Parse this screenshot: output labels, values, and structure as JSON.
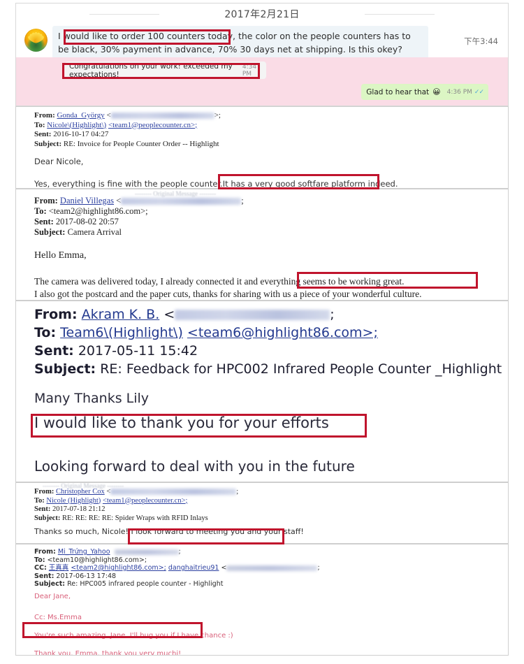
{
  "chat": {
    "date_label": "2017年2月21日",
    "avatar_name": "sunflower-avatar",
    "incoming_message": "I would like to order 100 counters today, the color on the people counters has to be black, 30% payment in advance, 70% 30 days net at shipping.  Is this okey?",
    "incoming_time": "下午3:44",
    "grey_message": "Congratulations on your work! exceeded my expectations!",
    "grey_time": "4:34 PM",
    "green_message": "Glad to hear that",
    "green_emoji": "😀",
    "green_time": "4:36 PM",
    "green_ticks": "✓✓"
  },
  "mail1": {
    "from_label": "From:",
    "from_name": "Gonda_György",
    "from_bracket_open": "<",
    "from_bracket_close": ">;",
    "to_label": "To:",
    "to_name": "Nicole\\(Highlight\\)",
    "to_address": "<team1@peoplecounter.cn>;",
    "sent_label": "Sent:",
    "sent_value": "2016-10-17 04:27",
    "subject_label": "Subject:",
    "subject_value": "RE: Invoice for People Counter Order -- Highlight",
    "greeting": "Dear Nicole,",
    "body_plain": "Yes, everything is fine with the people counter.",
    "body_highlighted": "It has a very good softfare platform indeed."
  },
  "mail2": {
    "original_message": "-------- Original Message --------",
    "from_label": "From:",
    "from_name": "Daniel Villegas",
    "from_bracket_open": "<",
    "from_bracket_close": ";",
    "to_label": "To:",
    "to_address": "<team2@highlight86.com>;",
    "sent_label": "Sent:",
    "sent_value": "2017-08-02 20:57",
    "subject_label": "Subject:",
    "subject_value": "Camera Arrival",
    "greeting": "Hello Emma,",
    "body_line1_plain": "The camera was delivered today, I already connected it and ",
    "body_line1_highlighted": "everything seems to be working great.",
    "body_line2": "I also got the postcard and the paper cuts, thanks for sharing with us a piece of your wonderful culture."
  },
  "mail3": {
    "from_label": "From:",
    "from_name": "Akram K. B.",
    "from_bracket_open": "<",
    "from_bracket_close": ";",
    "to_label": "To:",
    "to_name": "Team6\\(Highlight\\)",
    "to_address": "<team6@highlight86.com>;",
    "sent_label": "Sent:",
    "sent_value": "2017-05-11 15:42",
    "subject_label": "Subject:",
    "subject_value": "RE: Feedback for HPC002 Infrared People Counter _Highlight",
    "line1": "Many Thanks Lily",
    "line2_highlighted": "I would like to thank you for your efforts",
    "line3": "Looking forward to deal with you in the future"
  },
  "mail4": {
    "original_message": "-------- Original Message --------",
    "from_label": "From:",
    "from_name": "Christopher Cox",
    "from_bracket_open": "<",
    "from_bracket_close": ";",
    "to_label": "To:",
    "to_name": "Nicole (Highlight)",
    "to_address": "<team1@peoplecounter.cn>;",
    "sent_label": "Sent:",
    "sent_value": "2017-07-18 21:12",
    "subject_label": "Subject:",
    "subject_value": "RE: RE: RE: RE: Spider Wraps with RFID Inlays",
    "body_plain": "Thanks so much, Nicole!",
    "body_highlighted": "I look forward to meeting you and your staff!"
  },
  "mail5": {
    "from_label": "From:",
    "from_name": "Mi_Trứng_Yahoo",
    "from_bracket_close": ";",
    "to_label": "To:",
    "to_address": "<team10@highlight86.com>;",
    "cc_label": "CC:",
    "cc_name": "王真真",
    "cc_address": "<team2@highlight86.com>;",
    "cc_name2": "danghaitrieu91",
    "cc_bracket_open": "<",
    "cc_bracket_close": ";",
    "sent_label": "Sent:",
    "sent_value": "2017-06-13 17:48",
    "subject_label": "Subject:",
    "subject_value": "Re: HPC005 infrared people counter - Highlight",
    "greeting": "Dear Jane,",
    "cc_line": "Cc: Ms.Emma",
    "body_highlighted": "You're such amazing, Jane. I'll hug you if I have chance :)",
    "body_closing": "Thank you, Emma, thank you very muchj!"
  },
  "colors": {
    "highlight_box": "#c0142d",
    "chat_pink_background": "#fadce6",
    "chat_green_bubble": "#dcf6c4",
    "chat_incoming_bubble": "#eef4f8",
    "pink_text": "#d9607a",
    "link_blue": "#2b3fa0"
  }
}
